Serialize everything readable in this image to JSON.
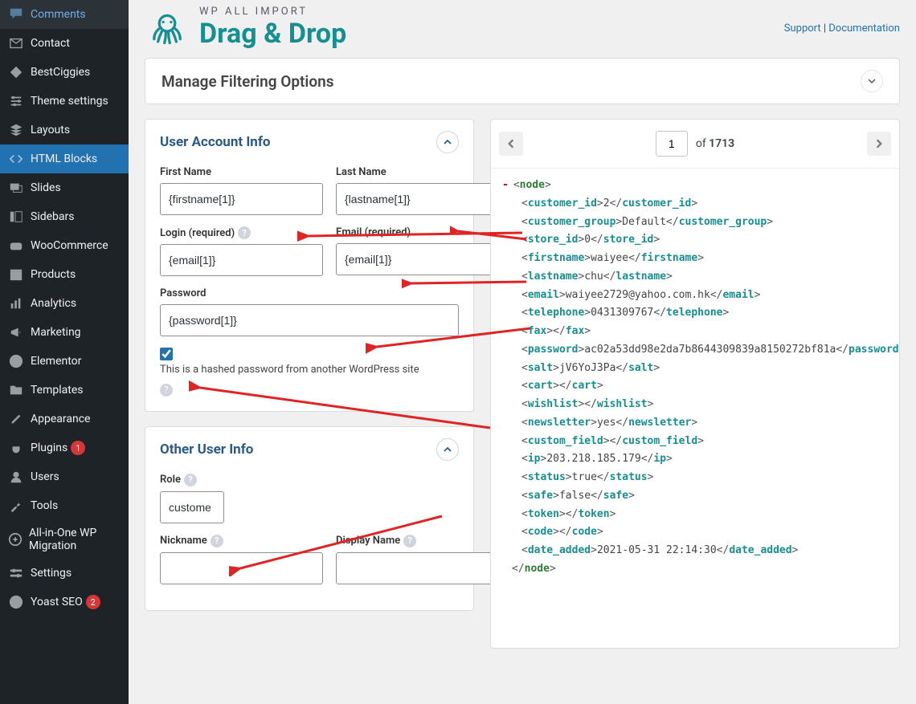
{
  "sidebar": {
    "items": [
      {
        "label": "Comments",
        "icon": "comment"
      },
      {
        "label": "Contact",
        "icon": "mail"
      },
      {
        "label": "BestCiggies",
        "icon": "diamond"
      },
      {
        "label": "Theme settings",
        "icon": "sliders"
      },
      {
        "label": "Layouts",
        "icon": "layers"
      },
      {
        "label": "HTML Blocks",
        "icon": "code",
        "active": true
      },
      {
        "label": "Slides",
        "icon": "slides"
      },
      {
        "label": "Sidebars",
        "icon": "sidebar"
      },
      {
        "label": "WooCommerce",
        "icon": "woo"
      },
      {
        "label": "Products",
        "icon": "archive"
      },
      {
        "label": "Analytics",
        "icon": "bars"
      },
      {
        "label": "Marketing",
        "icon": "megaphone"
      },
      {
        "label": "Elementor",
        "icon": "elementor"
      },
      {
        "label": "Templates",
        "icon": "folder"
      },
      {
        "label": "Appearance",
        "icon": "brush"
      },
      {
        "label": "Plugins",
        "icon": "plug",
        "badge": "1"
      },
      {
        "label": "Users",
        "icon": "user"
      },
      {
        "label": "Tools",
        "icon": "wrench"
      },
      {
        "label": "All-in-One WP Migration",
        "icon": "migrate"
      },
      {
        "label": "Settings",
        "icon": "settings"
      },
      {
        "label": "Yoast SEO",
        "icon": "yoast",
        "badge": "2"
      }
    ]
  },
  "header": {
    "brand_top": "WP ALL IMPORT",
    "brand_title": "Drag & Drop",
    "support": "Support",
    "docs": "Documentation",
    "sep": " | "
  },
  "filter_panel": {
    "title": "Manage Filtering Options"
  },
  "sections": {
    "account": {
      "title": "User Account Info",
      "first_name_label": "First Name",
      "first_name_value": "{firstname[1]}",
      "last_name_label": "Last Name",
      "last_name_value": "{lastname[1]}",
      "login_label": "Login (required)",
      "login_value": "{email[1]}",
      "email_label": "Email (required)",
      "email_value": "{email[1]}",
      "password_label": "Password",
      "password_value": "{password[1]}",
      "hashed_checked": true,
      "hashed_text": "This is a hashed password from another WordPress site"
    },
    "other": {
      "title": "Other User Info",
      "role_label": "Role",
      "role_value": "custome",
      "nickname_label": "Nickname",
      "nickname_value": "",
      "display_label": "Display Name",
      "display_value": ""
    }
  },
  "pager": {
    "current": "1",
    "of_label": "of",
    "total": "1713"
  },
  "xml": {
    "root": "node",
    "fields": [
      {
        "k": "customer_id",
        "v": "2"
      },
      {
        "k": "customer_group",
        "v": "Default"
      },
      {
        "k": "store_id",
        "v": "0"
      },
      {
        "k": "firstname",
        "v": "waiyee"
      },
      {
        "k": "lastname",
        "v": "chu"
      },
      {
        "k": "email",
        "v": "waiyee2729@yahoo.com.hk"
      },
      {
        "k": "telephone",
        "v": "0431309767"
      },
      {
        "k": "fax",
        "v": ""
      },
      {
        "k": "password",
        "v": "ac02a53dd98e2da7b8644309839a8150272bf81a"
      },
      {
        "k": "salt",
        "v": "jV6YoJ3Pa"
      },
      {
        "k": "cart",
        "v": ""
      },
      {
        "k": "wishlist",
        "v": ""
      },
      {
        "k": "newsletter",
        "v": "yes"
      },
      {
        "k": "custom_field",
        "v": ""
      },
      {
        "k": "ip",
        "v": "203.218.185.179"
      },
      {
        "k": "status",
        "v": "true"
      },
      {
        "k": "safe",
        "v": "false"
      },
      {
        "k": "token",
        "v": ""
      },
      {
        "k": "code",
        "v": ""
      },
      {
        "k": "date_added",
        "v": "2021-05-31 22:14:30"
      }
    ]
  }
}
